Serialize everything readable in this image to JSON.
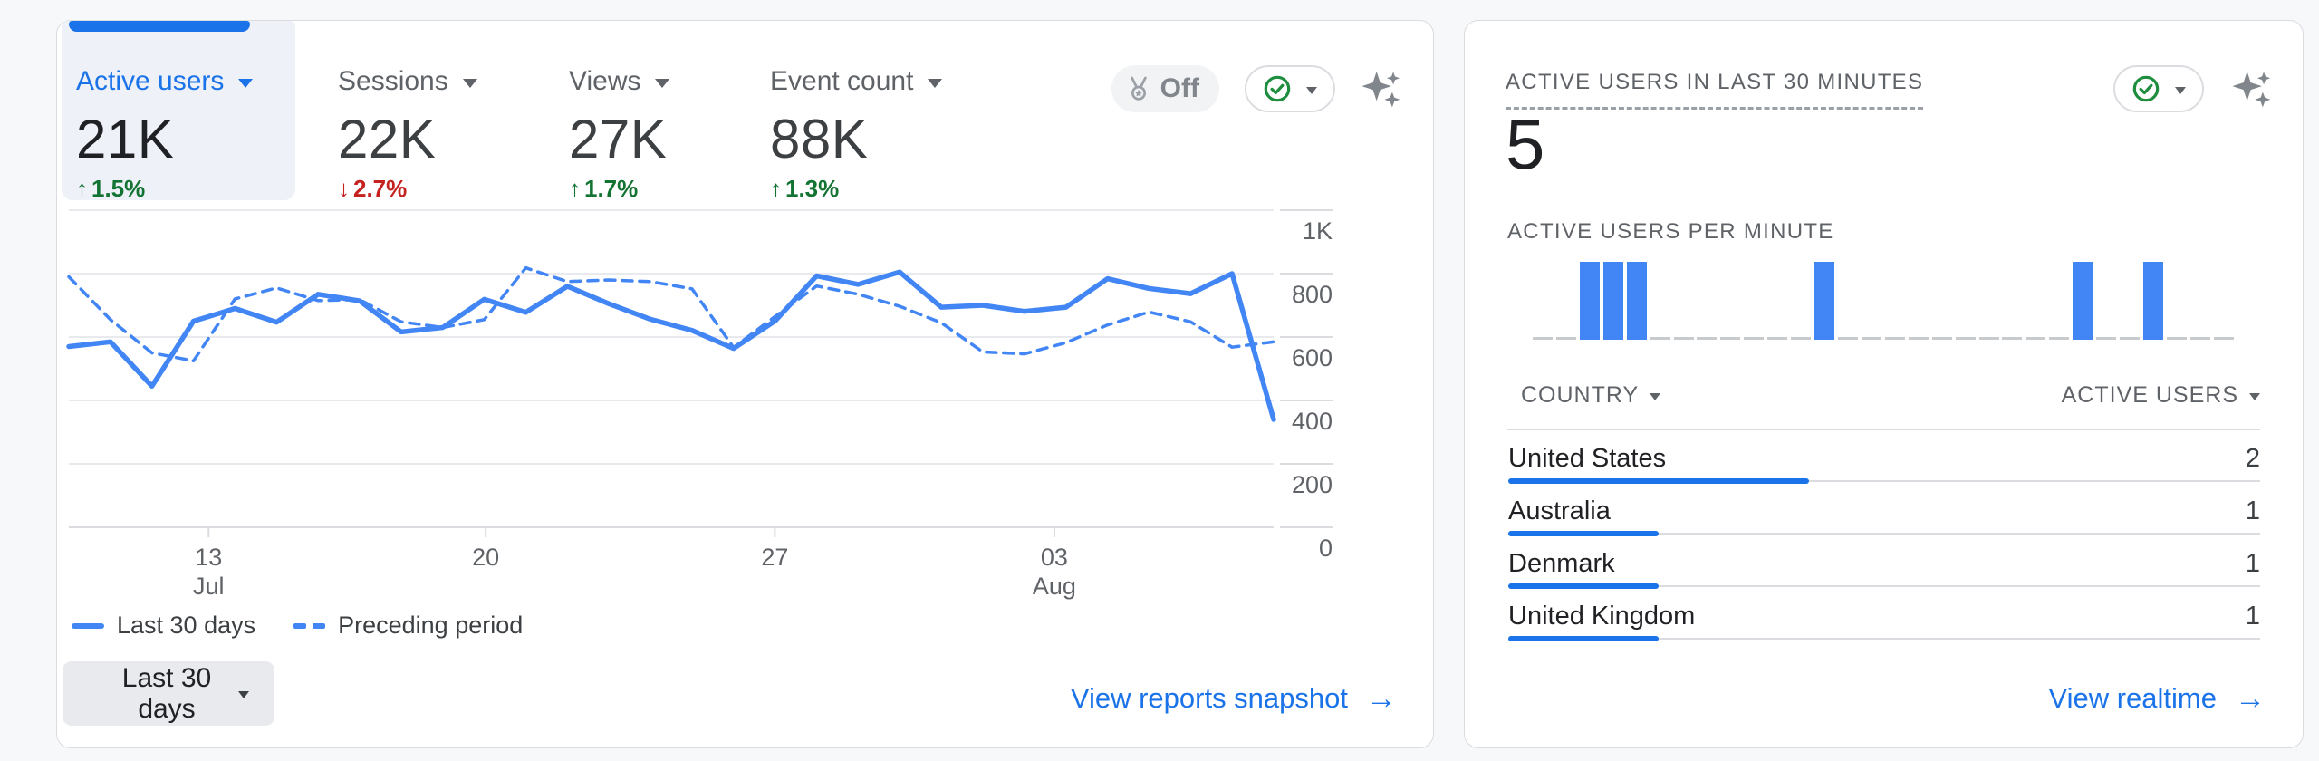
{
  "colors": {
    "accent_blue": "#1a73e8",
    "line_blue": "#4285f4",
    "delta_green": "#137333",
    "delta_red": "#c5221f",
    "text_gray": "#5f6368",
    "grid_gray": "#e8eaed",
    "axis_gray": "#dadce0"
  },
  "left_card": {
    "tabs": [
      {
        "label": "Active users",
        "value": "21K",
        "delta": "1.5%",
        "direction": "up",
        "selected": true
      },
      {
        "label": "Sessions",
        "value": "22K",
        "delta": "2.7%",
        "direction": "down",
        "selected": false
      },
      {
        "label": "Views",
        "value": "27K",
        "delta": "1.7%",
        "direction": "up",
        "selected": false
      },
      {
        "label": "Event count",
        "value": "88K",
        "delta": "1.3%",
        "direction": "up",
        "selected": false
      }
    ],
    "delta_up_arrow": "↑",
    "delta_down_arrow": "↓",
    "off_badge": {
      "label": "Off"
    },
    "date_range_button": {
      "label": "Last 30 days"
    },
    "footer_link": {
      "label": "View reports snapshot",
      "arrow": "→"
    }
  },
  "chart_data": {
    "type": "line",
    "title": "Active users trend (last 30 days vs preceding period)",
    "ylim": [
      0,
      1000
    ],
    "grid": "horizontal",
    "legend_position": "bottom-left",
    "y_ticks": [
      {
        "label": "0",
        "value": 0
      },
      {
        "label": "200",
        "value": 200
      },
      {
        "label": "400",
        "value": 400
      },
      {
        "label": "600",
        "value": 600
      },
      {
        "label": "800",
        "value": 800
      },
      {
        "label": "1K",
        "value": 1000
      }
    ],
    "x_ticks": [
      {
        "line1": "13",
        "line2": "Jul",
        "pos": 0.116
      },
      {
        "line1": "20",
        "line2": "",
        "pos": 0.346
      },
      {
        "line1": "27",
        "line2": "",
        "pos": 0.586
      },
      {
        "line1": "03",
        "line2": "Aug",
        "pos": 0.818
      }
    ],
    "series": [
      {
        "name": "Last 30 days",
        "style": "solid",
        "values": [
          570,
          585,
          445,
          650,
          690,
          647,
          735,
          714,
          616,
          630,
          719,
          678,
          760,
          705,
          656,
          621,
          564,
          651,
          793,
          766,
          805,
          694,
          700,
          681,
          694,
          784,
          753,
          737,
          800,
          340
        ]
      },
      {
        "name": "Preceding period",
        "style": "dashed",
        "values": [
          790,
          655,
          550,
          525,
          720,
          755,
          715,
          718,
          648,
          630,
          655,
          818,
          775,
          780,
          775,
          752,
          567,
          665,
          761,
          735,
          697,
          645,
          553,
          547,
          582,
          638,
          679,
          648,
          568,
          585
        ]
      }
    ]
  },
  "right_card": {
    "title": "ACTIVE USERS IN LAST 30 MINUTES",
    "value": "5",
    "per_minute_label": "ACTIVE USERS PER MINUTE",
    "minute_chart": {
      "type": "bar",
      "slots": 30,
      "values": [
        0,
        0,
        1,
        1,
        1,
        0,
        0,
        0,
        0,
        0,
        0,
        0,
        1,
        0,
        0,
        0,
        0,
        0,
        0,
        0,
        0,
        0,
        0,
        1,
        0,
        0,
        1,
        0,
        0,
        0
      ]
    },
    "table": {
      "col1": "COUNTRY",
      "col2": "ACTIVE USERS",
      "rows": [
        {
          "country": "United States",
          "users": "2",
          "bar": 0.4
        },
        {
          "country": "Australia",
          "users": "1",
          "bar": 0.2
        },
        {
          "country": "Denmark",
          "users": "1",
          "bar": 0.2
        },
        {
          "country": "United Kingdom",
          "users": "1",
          "bar": 0.2
        }
      ]
    },
    "footer_link": {
      "label": "View realtime",
      "arrow": "→"
    }
  }
}
